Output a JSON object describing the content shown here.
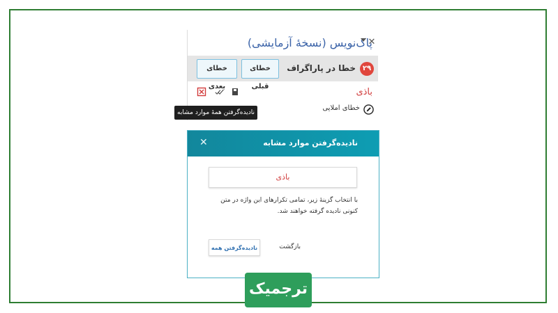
{
  "panel": {
    "title": "پاک‌نویس (نسخهٔ آزمایشی)",
    "close_glyph": "✕",
    "error_count": "۲۹",
    "error_label": "خطا در پاراگراف",
    "prev_button": "خطای قبلی",
    "next_button": "خطای بعدی",
    "word": "باذی",
    "error_type": "خطای املایی"
  },
  "tooltip": {
    "text": "نادیده‌گرفتن همهٔ موارد مشابه"
  },
  "dialog": {
    "title": "نادیده‌گرفتن موارد مشابه",
    "close_glyph": "✕",
    "word": "باذی",
    "description": "با انتخاب گزینهٔ زیر، تمامی تکرارهای این واژه در متن کنونی نادیده گرفته خواهند شد.",
    "back_label": "بازگشت",
    "ignore_all_button": "نادیده‌گرفتن همه"
  },
  "logo": {
    "text": "ترجمیک"
  },
  "colors": {
    "frame": "#2e7d32",
    "title_blue": "#3b63a8",
    "error_red": "#d13b3b",
    "badge_red": "#e0463c",
    "dialog_teal": "#12879c",
    "logo_green": "#2e9e5b"
  }
}
